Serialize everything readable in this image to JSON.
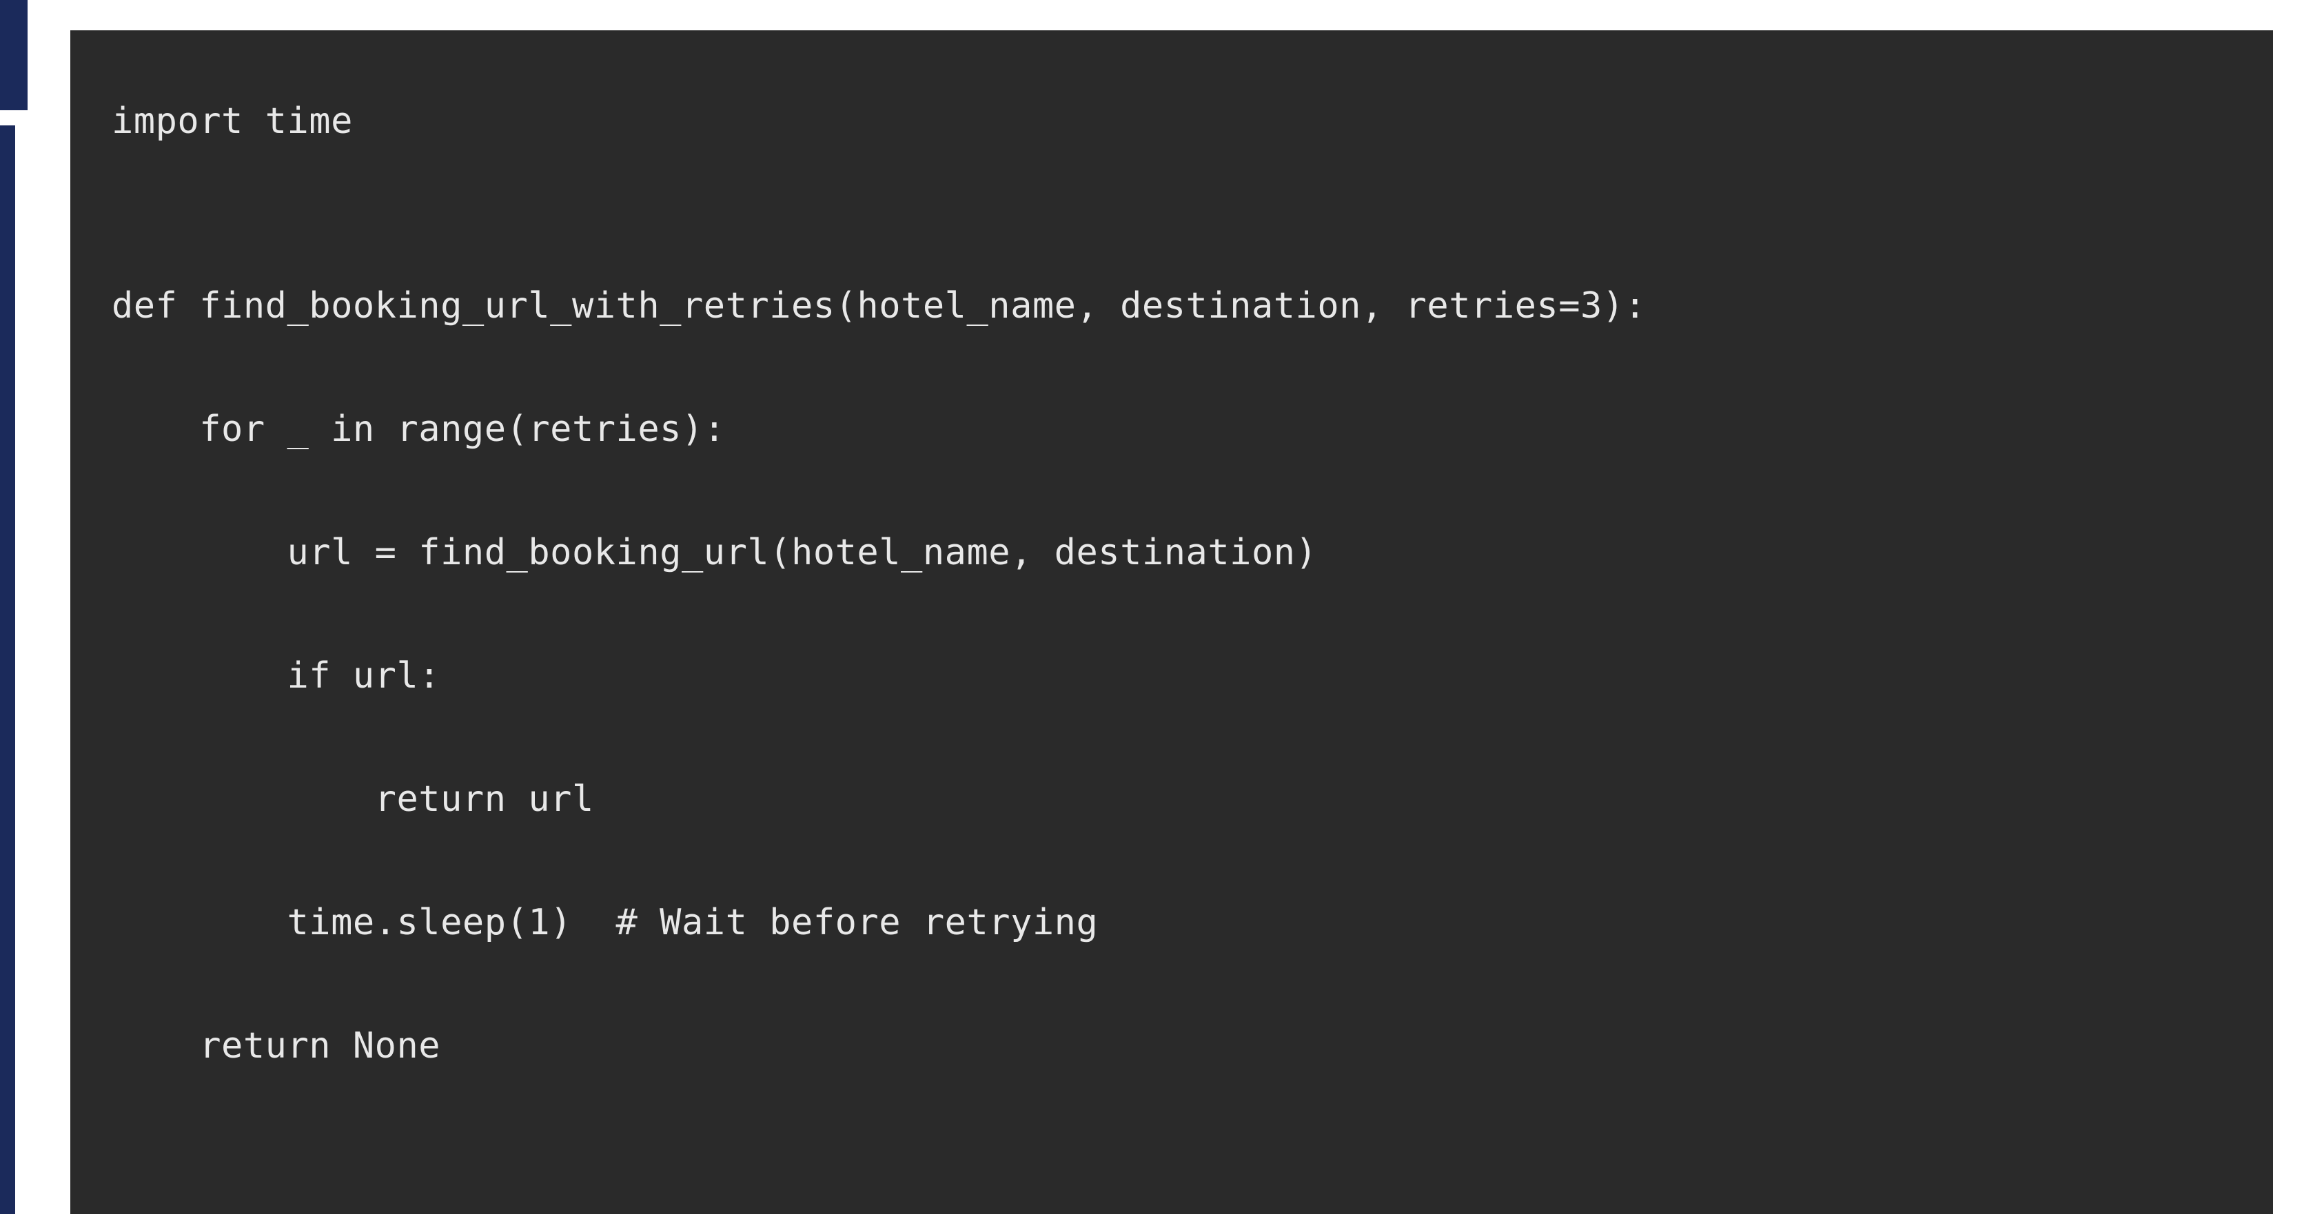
{
  "code": {
    "language": "python",
    "lines": [
      "import time",
      "",
      "",
      "def find_booking_url_with_retries(hotel_name, destination, retries=3):",
      "",
      "    for _ in range(retries):",
      "",
      "        url = find_booking_url(hotel_name, destination)",
      "",
      "        if url:",
      "",
      "            return url",
      "",
      "        time.sleep(1)  # Wait before retrying",
      "",
      "    return None"
    ]
  },
  "colors": {
    "background_page": "#ffffff",
    "sidebar": "#1b2a5b",
    "code_panel_bg": "#2a2a2a",
    "code_text": "#e8e8e8"
  }
}
